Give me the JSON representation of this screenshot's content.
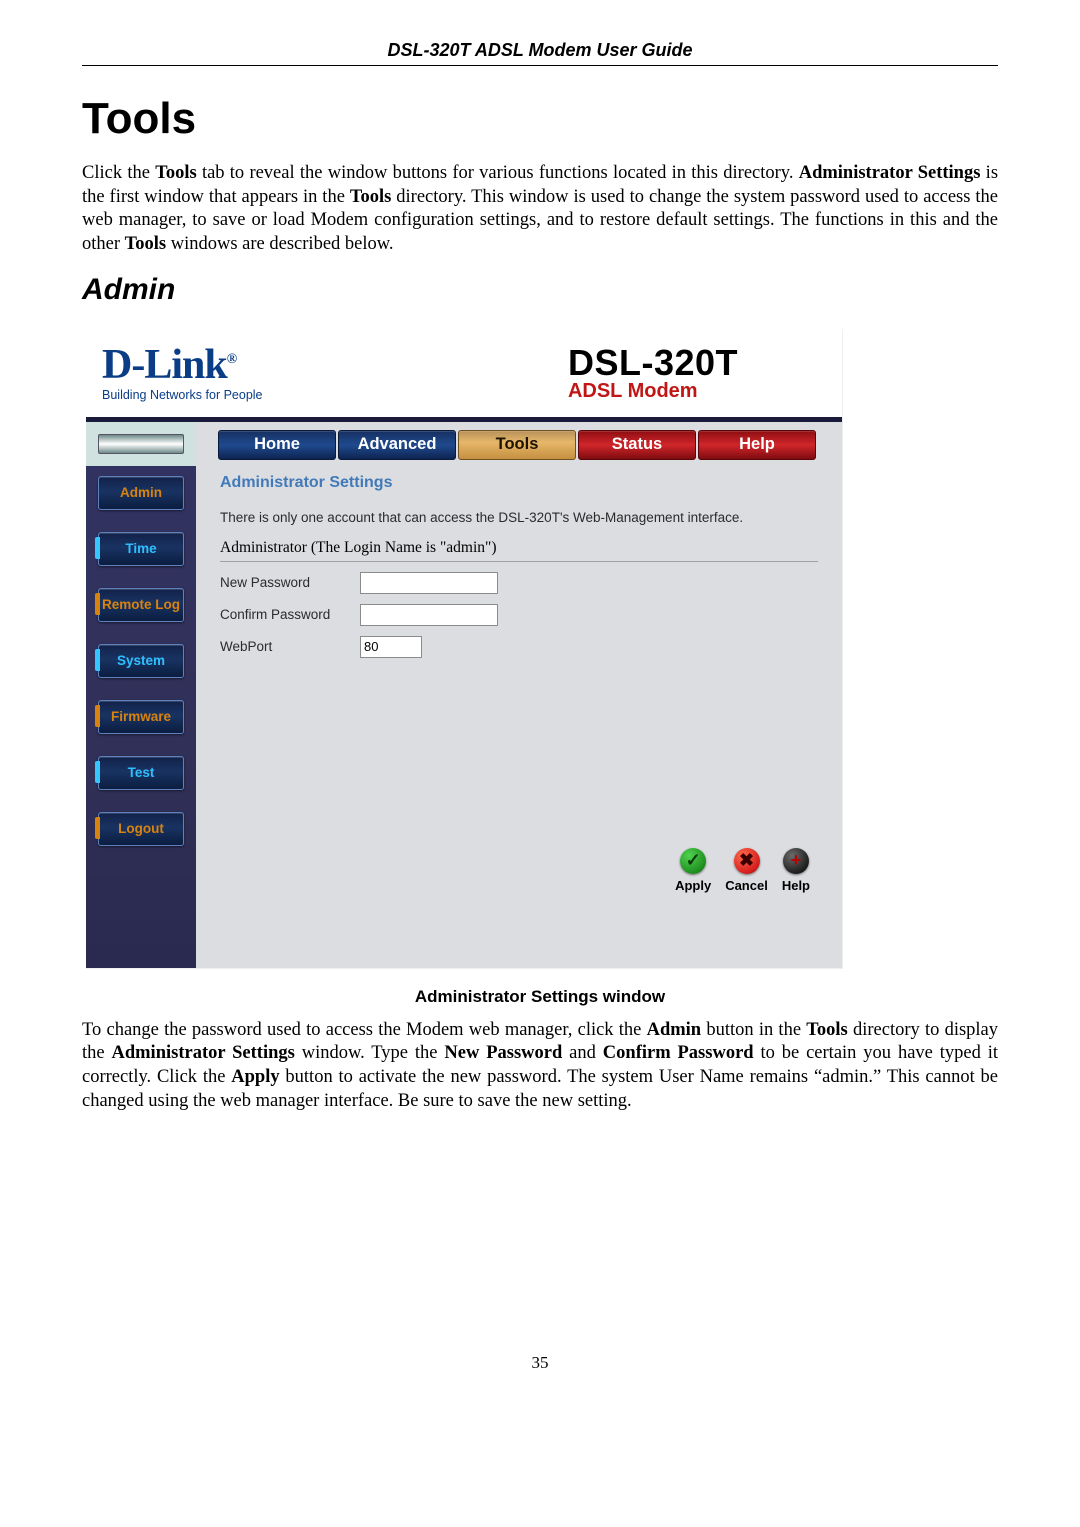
{
  "doc": {
    "header": "DSL-320T ADSL Modem User Guide",
    "h1": "Tools",
    "para1_a": "Click the ",
    "para1_b_bold": "Tools",
    "para1_c": " tab to reveal the window buttons for various functions located in this directory. ",
    "para1_d_bold": "Administrator Settings",
    "para1_e": " is the first window that appears in the ",
    "para1_f_bold": "Tools",
    "para1_g": " directory. This window is used to change the system password used to access the web manager, to save or load Modem configuration settings, and to restore default settings. The functions in this and the other ",
    "para1_h_bold": "Tools",
    "para1_i": " windows are described below.",
    "h2": "Admin",
    "caption": "Administrator Settings window",
    "para2_a": "To change the password used to access the Modem web manager, click the ",
    "para2_b_bold": "Admin",
    "para2_c": " button in the ",
    "para2_d_bold": "Tools",
    "para2_e": " directory to display the ",
    "para2_f_bold": "Administrator Settings",
    "para2_g": " window. Type the ",
    "para2_h_bold": "New Password",
    "para2_i": " and ",
    "para2_j_bold": "Confirm Password",
    "para2_k": " to be certain you have typed it correctly. Click the ",
    "para2_l_bold": "Apply",
    "para2_m": " button to activate the new password. The system User Name remains “admin.” This cannot be changed using the web manager interface. Be sure to save the new setting.",
    "pagenum": "35"
  },
  "ui": {
    "brand": "D-Link",
    "brand_reg": "®",
    "brand_tag": "Building Networks for People",
    "model_name": "DSL-320T",
    "model_sub": "ADSL Modem",
    "tabs": {
      "home": "Home",
      "advanced": "Advanced",
      "tools": "Tools",
      "status": "Status",
      "help": "Help"
    },
    "side": {
      "admin": "Admin",
      "time": "Time",
      "remote": "Remote Log",
      "system": "System",
      "firmware": "Firmware",
      "test": "Test",
      "logout": "Logout"
    },
    "panel": {
      "title": "Administrator Settings",
      "desc": "There is only one account that can access the DSL-320T's Web-Management interface.",
      "legend": "Administrator (The Login Name is \"admin\")",
      "new_pw_label": "New Password",
      "confirm_pw_label": "Confirm Password",
      "webport_label": "WebPort",
      "webport_value": "80"
    },
    "buttons": {
      "apply": "Apply",
      "cancel": "Cancel",
      "help": "Help",
      "apply_glyph": "✓",
      "cancel_glyph": "✖",
      "help_glyph": "+"
    }
  }
}
